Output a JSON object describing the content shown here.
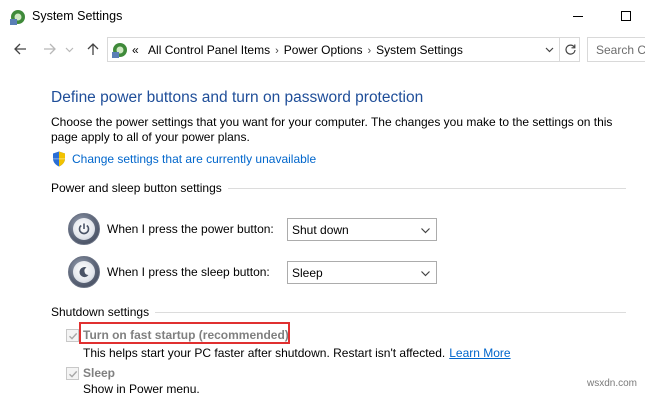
{
  "window": {
    "title": "System Settings",
    "minimize_icon": "minimize-icon",
    "maximize_icon": "maximize-icon"
  },
  "nav": {
    "back_icon": "arrow-left-icon",
    "forward_icon": "arrow-right-icon",
    "history_icon": "chevron-down-icon",
    "up_icon": "arrow-up-icon",
    "breadcrumb_prefix": "«",
    "breadcrumbs": [
      "All Control Panel Items",
      "Power Options",
      "System Settings"
    ],
    "separator": "›",
    "refresh_icon": "refresh-icon",
    "search_placeholder": "Search Co"
  },
  "page": {
    "heading": "Define power buttons and turn on password protection",
    "description": "Choose the power settings that you want for your computer. The changes you make to the settings on this page apply to all of your power plans.",
    "change_link": "Change settings that are currently unavailable"
  },
  "power_group": {
    "title": "Power and sleep button settings",
    "rows": [
      {
        "label": "When I press the power button:",
        "value": "Shut down",
        "icon": "power-button-icon"
      },
      {
        "label": "When I press the sleep button:",
        "value": "Sleep",
        "icon": "sleep-button-icon"
      }
    ]
  },
  "shutdown_group": {
    "title": "Shutdown settings",
    "items": [
      {
        "label": "Turn on fast startup (recommended)",
        "checked": true,
        "description": "This helps start your PC faster after shutdown. Restart isn't affected.",
        "link": "Learn More"
      },
      {
        "label": "Sleep",
        "checked": true,
        "description": "Show in Power menu."
      }
    ]
  },
  "colors": {
    "heading": "#1f4e99",
    "link": "#0066cc",
    "highlight_box": "#e03030",
    "disabled_text": "#808080"
  },
  "watermark": "wsxdn.com"
}
